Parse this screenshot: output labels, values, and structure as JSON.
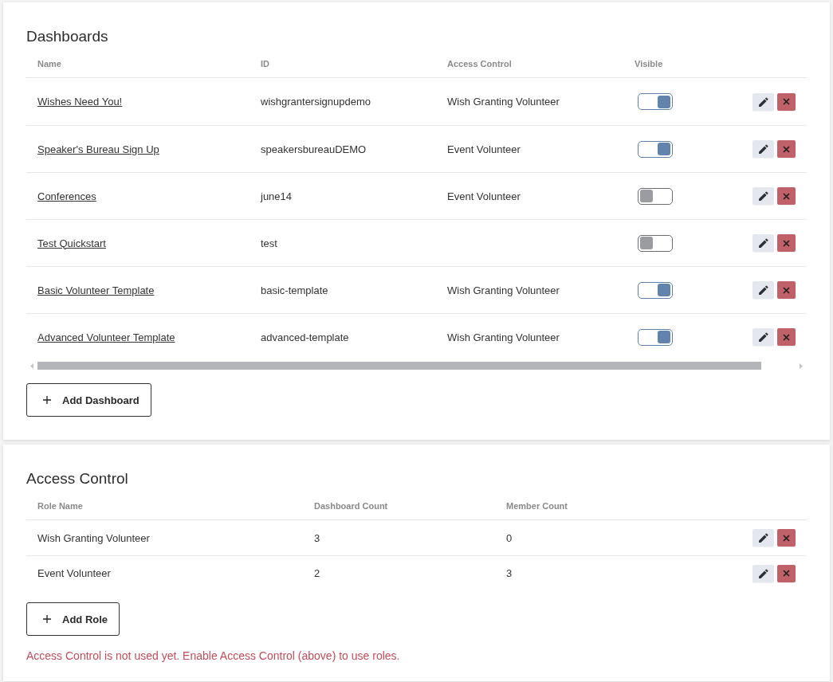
{
  "dashboards": {
    "title": "Dashboards",
    "columns": [
      "Name",
      "ID",
      "Access Control",
      "Visible"
    ],
    "rows": [
      {
        "name": "Wishes Need You!",
        "id": "wishgrantersignupdemo",
        "access_control": "Wish Granting Volunteer",
        "visible": true
      },
      {
        "name": "Speaker's Bureau Sign Up",
        "id": "speakersbureauDEMO",
        "access_control": "Event Volunteer",
        "visible": true
      },
      {
        "name": "Conferences",
        "id": "june14",
        "access_control": "Event Volunteer",
        "visible": false
      },
      {
        "name": "Test Quickstart",
        "id": "test",
        "visible": false
      },
      {
        "name": "Basic Volunteer Template",
        "id": "basic-template",
        "access_control": "Wish Granting Volunteer",
        "visible": true
      },
      {
        "name": "Advanced Volunteer Template",
        "id": "advanced-template",
        "access_control": "Wish Granting Volunteer",
        "visible": true
      }
    ],
    "add_button": "Add Dashboard"
  },
  "access_control": {
    "title": "Access Control",
    "columns": [
      "Role Name",
      "Dashboard Count",
      "Member Count"
    ],
    "rows": [
      {
        "role_name": "Wish Granting Volunteer",
        "dashboard_count": "3",
        "member_count": "0"
      },
      {
        "role_name": "Event Volunteer",
        "dashboard_count": "2",
        "member_count": "3"
      }
    ],
    "add_button": "Add Role",
    "notice": "Access Control is not used yet. Enable Access Control (above) to use roles."
  }
}
